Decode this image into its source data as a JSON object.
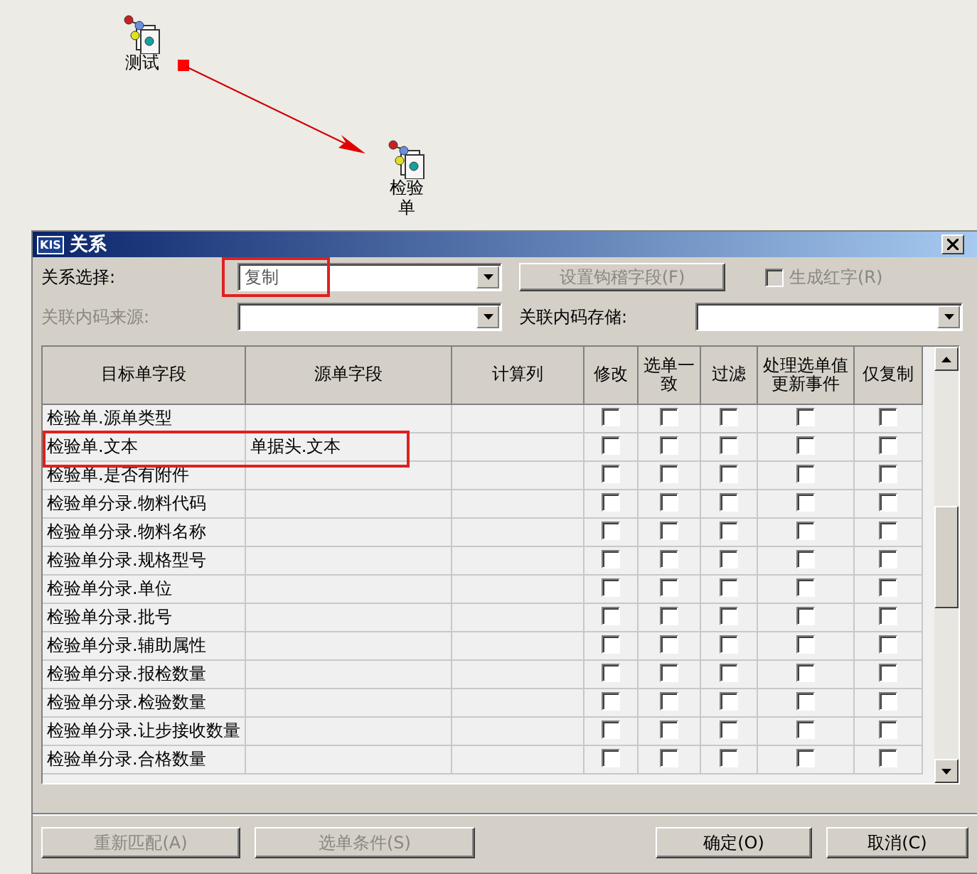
{
  "canvas": {
    "nodes": [
      {
        "label": "测试"
      },
      {
        "label": "检验单"
      }
    ]
  },
  "dialog": {
    "title": "关系",
    "icon_text": "KIS",
    "relation_select": {
      "label": "关系选择:",
      "value": "复制",
      "highlighted": true
    },
    "hook_button": {
      "label": "设置钩稽字段(F)",
      "disabled": true
    },
    "red_checkbox": {
      "label": "生成红字(R)",
      "checked": false,
      "disabled": true
    },
    "source_code": {
      "label": "关联内码来源:",
      "disabled": true
    },
    "store_code": {
      "label": "关联内码存储:",
      "disabled": false
    },
    "table": {
      "columns": [
        "目标单字段",
        "源单字段",
        "计算列",
        "修改",
        "选单一致",
        "过滤",
        "处理选单值更新事件",
        "仅复制"
      ],
      "rows": [
        {
          "target": "检验单.源单类型",
          "source": "",
          "highlighted": false,
          "checks": [
            false,
            false,
            false,
            false,
            false
          ]
        },
        {
          "target": "检验单.文本",
          "source": "单据头.文本",
          "highlighted": true,
          "checks": [
            false,
            false,
            false,
            false,
            false
          ]
        },
        {
          "target": "检验单.是否有附件",
          "source": "",
          "highlighted": false,
          "checks": [
            false,
            false,
            false,
            false,
            false
          ]
        },
        {
          "target": "检验单分录.物料代码",
          "source": "",
          "highlighted": false,
          "checks": [
            false,
            false,
            false,
            false,
            false
          ]
        },
        {
          "target": "检验单分录.物料名称",
          "source": "",
          "highlighted": false,
          "checks": [
            false,
            false,
            false,
            false,
            false
          ]
        },
        {
          "target": "检验单分录.规格型号",
          "source": "",
          "highlighted": false,
          "checks": [
            false,
            false,
            false,
            false,
            false
          ]
        },
        {
          "target": "检验单分录.单位",
          "source": "",
          "highlighted": false,
          "checks": [
            false,
            false,
            false,
            false,
            false
          ]
        },
        {
          "target": "检验单分录.批号",
          "source": "",
          "highlighted": false,
          "checks": [
            false,
            false,
            false,
            false,
            false
          ]
        },
        {
          "target": "检验单分录.辅助属性",
          "source": "",
          "highlighted": false,
          "checks": [
            false,
            false,
            false,
            false,
            false
          ]
        },
        {
          "target": "检验单分录.报检数量",
          "source": "",
          "highlighted": false,
          "checks": [
            false,
            false,
            false,
            false,
            false
          ]
        },
        {
          "target": "检验单分录.检验数量",
          "source": "",
          "highlighted": false,
          "checks": [
            false,
            false,
            false,
            false,
            false
          ]
        },
        {
          "target": "检验单分录.让步接收数量",
          "source": "",
          "highlighted": false,
          "checks": [
            false,
            false,
            false,
            false,
            false
          ]
        },
        {
          "target": "检验单分录.合格数量",
          "source": "",
          "highlighted": false,
          "checks": [
            false,
            false,
            false,
            false,
            false
          ]
        }
      ]
    },
    "buttons": [
      {
        "label": "重新匹配(A)",
        "disabled": true
      },
      {
        "label": "选单条件(S)",
        "disabled": true
      },
      {
        "label": "确定(O)",
        "disabled": false
      },
      {
        "label": "取消(C)",
        "disabled": false
      }
    ]
  }
}
